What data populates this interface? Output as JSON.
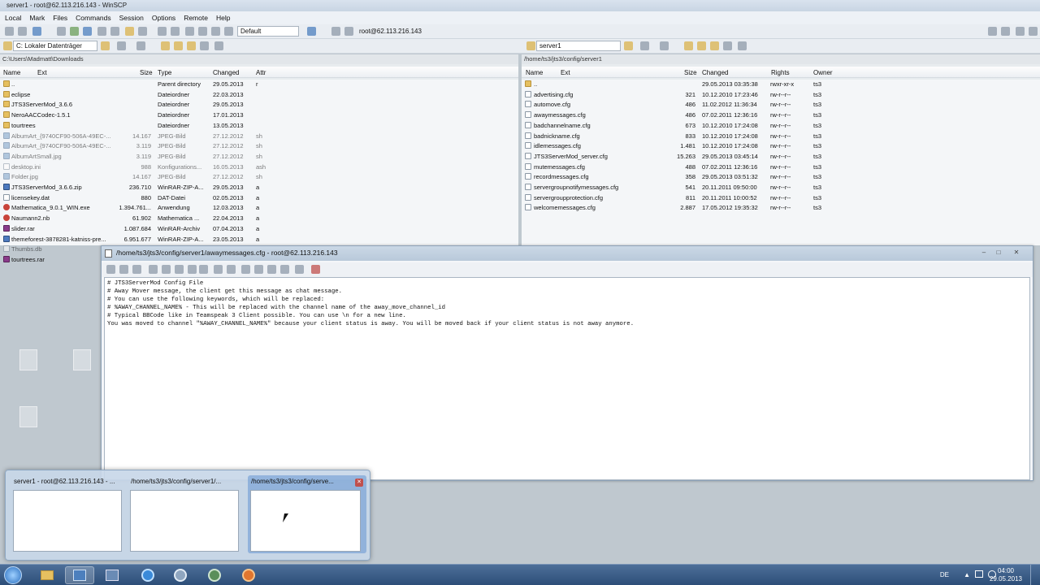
{
  "window_title": "server1 - root@62.113.216.143 - WinSCP",
  "menu": [
    "Local",
    "Mark",
    "Files",
    "Commands",
    "Session",
    "Options",
    "Remote",
    "Help"
  ],
  "toolbar": {
    "profile": "Default",
    "session": "root@62.113.216.143"
  },
  "left": {
    "drive": "C: Lokaler Datenträger",
    "path": "C:\\Users\\Madmatt\\Downloads",
    "headers": [
      "Name",
      "Ext",
      "Size",
      "Type",
      "Changed",
      "Attr"
    ],
    "rows": [
      {
        "name": "..",
        "size": "",
        "type": "Parent directory",
        "changed": "29.05.2013",
        "attr": "r",
        "icon": "up"
      },
      {
        "name": "eclipse",
        "size": "",
        "type": "Dateiordner",
        "changed": "22.03.2013",
        "attr": "",
        "icon": "dir"
      },
      {
        "name": "JTS3ServerMod_3.6.6",
        "size": "",
        "type": "Dateiordner",
        "changed": "29.05.2013",
        "attr": "",
        "icon": "dir"
      },
      {
        "name": "NeroAACCodec-1.5.1",
        "size": "",
        "type": "Dateiordner",
        "changed": "17.01.2013",
        "attr": "",
        "icon": "dir"
      },
      {
        "name": "tourtrees",
        "size": "",
        "type": "Dateiordner",
        "changed": "13.05.2013",
        "attr": "",
        "icon": "dir"
      },
      {
        "name": "AlbumArt_{9740CF90-506A-49EC-...",
        "size": "14.167",
        "type": "JPEG-Bild",
        "changed": "27.12.2012",
        "attr": "sh",
        "icon": "img",
        "ghost": true
      },
      {
        "name": "AlbumArt_{9740CF90-506A-49EC-...",
        "size": "3.119",
        "type": "JPEG-Bild",
        "changed": "27.12.2012",
        "attr": "sh",
        "icon": "img",
        "ghost": true
      },
      {
        "name": "AlbumArtSmall.jpg",
        "size": "3.119",
        "type": "JPEG-Bild",
        "changed": "27.12.2012",
        "attr": "sh",
        "icon": "img",
        "ghost": true
      },
      {
        "name": "desktop.ini",
        "size": "988",
        "type": "Konfigurations...",
        "changed": "16.05.2013",
        "attr": "ash",
        "icon": "file",
        "ghost": true
      },
      {
        "name": "Folder.jpg",
        "size": "14.167",
        "type": "JPEG-Bild",
        "changed": "27.12.2012",
        "attr": "sh",
        "icon": "img",
        "ghost": true
      },
      {
        "name": "JTS3ServerMod_3.6.6.zip",
        "size": "236.710",
        "type": "WinRAR-ZIP-A...",
        "changed": "29.05.2013",
        "attr": "a",
        "icon": "zip"
      },
      {
        "name": "licensekey.dat",
        "size": "880",
        "type": "DAT-Datei",
        "changed": "02.05.2013",
        "attr": "a",
        "icon": "file"
      },
      {
        "name": "Mathematica_9.0.1_WIN.exe",
        "size": "1.394.761...",
        "type": "Anwendung",
        "changed": "12.03.2013",
        "attr": "a",
        "icon": "exe"
      },
      {
        "name": "Naumann2.nb",
        "size": "61.902",
        "type": "Mathematica ...",
        "changed": "22.04.2013",
        "attr": "a",
        "icon": "exe"
      },
      {
        "name": "slider.rar",
        "size": "1.087.684",
        "type": "WinRAR-Archiv",
        "changed": "07.04.2013",
        "attr": "a",
        "icon": "rar"
      },
      {
        "name": "themeforest-3878281-katniss-pre...",
        "size": "6.951.677",
        "type": "WinRAR-ZIP-A...",
        "changed": "23.05.2013",
        "attr": "a",
        "icon": "zip"
      },
      {
        "name": "Thumbs.db",
        "size": "",
        "type": "",
        "changed": "",
        "attr": "",
        "icon": "file",
        "ghost": true
      },
      {
        "name": "tourtrees.rar",
        "size": "",
        "type": "",
        "changed": "",
        "attr": "",
        "icon": "rar"
      }
    ]
  },
  "right": {
    "folder": "server1",
    "path": "/home/ts3/jts3/config/server1",
    "headers": [
      "Name",
      "Ext",
      "Size",
      "Changed",
      "Rights",
      "Owner"
    ],
    "rows": [
      {
        "name": "..",
        "size": "",
        "changed": "29.05.2013 03:35:38",
        "rights": "rwxr-xr-x",
        "owner": "ts3",
        "icon": "up"
      },
      {
        "name": "advertising.cfg",
        "size": "321",
        "changed": "10.12.2010 17:23:46",
        "rights": "rw-r--r--",
        "owner": "ts3",
        "icon": "file"
      },
      {
        "name": "automove.cfg",
        "size": "486",
        "changed": "11.02.2012 11:36:34",
        "rights": "rw-r--r--",
        "owner": "ts3",
        "icon": "file"
      },
      {
        "name": "awaymessages.cfg",
        "size": "486",
        "changed": "07.02.2011 12:36:16",
        "rights": "rw-r--r--",
        "owner": "ts3",
        "icon": "file"
      },
      {
        "name": "badchannelname.cfg",
        "size": "673",
        "changed": "10.12.2010 17:24:08",
        "rights": "rw-r--r--",
        "owner": "ts3",
        "icon": "file"
      },
      {
        "name": "badnickname.cfg",
        "size": "833",
        "changed": "10.12.2010 17:24:08",
        "rights": "rw-r--r--",
        "owner": "ts3",
        "icon": "file"
      },
      {
        "name": "idlemessages.cfg",
        "size": "1.481",
        "changed": "10.12.2010 17:24:08",
        "rights": "rw-r--r--",
        "owner": "ts3",
        "icon": "file"
      },
      {
        "name": "JTS3ServerMod_server.cfg",
        "size": "15.263",
        "changed": "29.05.2013 03:45:14",
        "rights": "rw-r--r--",
        "owner": "ts3",
        "icon": "file"
      },
      {
        "name": "mutemessages.cfg",
        "size": "488",
        "changed": "07.02.2011 12:36:16",
        "rights": "rw-r--r--",
        "owner": "ts3",
        "icon": "file"
      },
      {
        "name": "recordmessages.cfg",
        "size": "358",
        "changed": "29.05.2013 03:51:32",
        "rights": "rw-r--r--",
        "owner": "ts3",
        "icon": "file"
      },
      {
        "name": "servergroupnotifymessages.cfg",
        "size": "541",
        "changed": "20.11.2011 09:50:00",
        "rights": "rw-r--r--",
        "owner": "ts3",
        "icon": "file"
      },
      {
        "name": "servergroupprotection.cfg",
        "size": "811",
        "changed": "20.11.2011 10:00:52",
        "rights": "rw-r--r--",
        "owner": "ts3",
        "icon": "file"
      },
      {
        "name": "welcomemessages.cfg",
        "size": "2.887",
        "changed": "17.05.2012 19:35:32",
        "rights": "rw-r--r--",
        "owner": "ts3",
        "icon": "file"
      }
    ]
  },
  "editor": {
    "title": "/home/ts3/jts3/config/server1/awaymessages.cfg - root@62.113.216.143",
    "lines": [
      "# JTS3ServerMod Config File",
      "# Away Mover message, the client get this message as chat message.",
      "# You can use the following keywords, which will be replaced:",
      "# %AWAY_CHANNEL_NAME% - This will be replaced with the channel name of the away_move_channel_id",
      "# Typical BBCode like in Teamspeak 3 Client possible. You can use \\n for a new line.",
      "You was moved to channel \"%AWAY_CHANNEL_NAME%\" because your client status is away. You will be moved back if your client status is not away anymore."
    ]
  },
  "previews": [
    {
      "title": "server1 - root@62.113.216.143 - ..."
    },
    {
      "title": "/home/ts3/jts3/config/server1/..."
    },
    {
      "title": "/home/ts3/jts3/config/serve..."
    }
  ],
  "taskbar": {
    "lang": "DE",
    "time": "04:00",
    "date": "29.05.2013"
  },
  "colors": {
    "taskbar": "#2d4e78",
    "accent": "#4c7fbd"
  }
}
